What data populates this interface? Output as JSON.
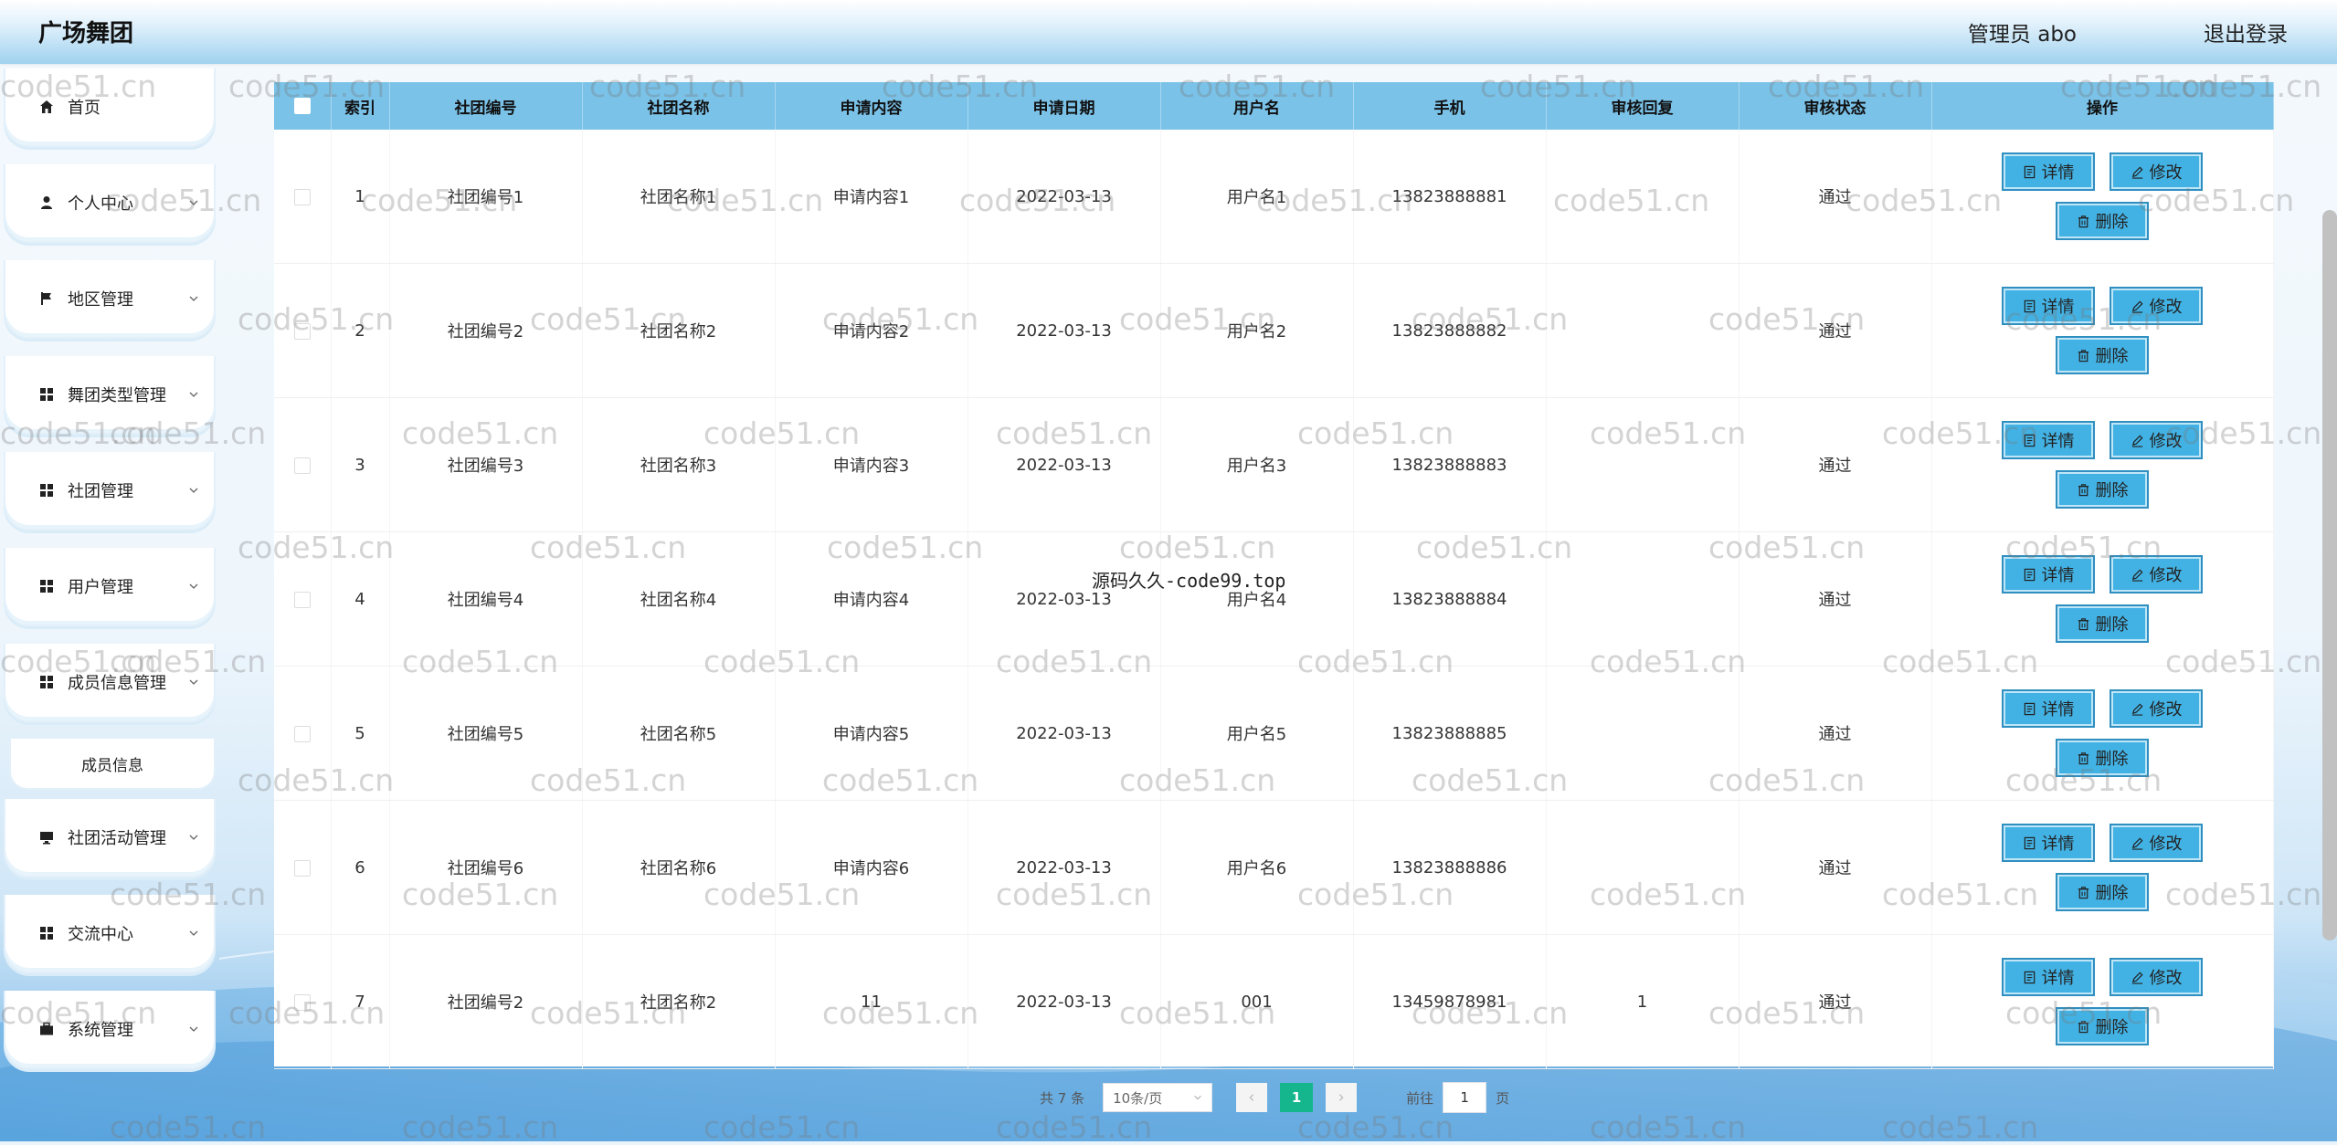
{
  "header": {
    "brand": "广场舞团",
    "admin": "管理员 abo",
    "logout": "退出登录"
  },
  "sidebar": {
    "items": [
      {
        "label": "首页",
        "icon": "home-icon",
        "expandable": false
      },
      {
        "label": "个人中心",
        "icon": "user-icon",
        "expandable": true
      },
      {
        "label": "地区管理",
        "icon": "flag-icon",
        "expandable": true
      },
      {
        "label": "舞团类型管理",
        "icon": "grid-icon",
        "expandable": true
      },
      {
        "label": "社团管理",
        "icon": "grid-icon",
        "expandable": true
      },
      {
        "label": "用户管理",
        "icon": "grid-icon",
        "expandable": true
      },
      {
        "label": "成员信息管理",
        "icon": "grid-icon",
        "expandable": true
      },
      {
        "label": "社团活动管理",
        "icon": "monitor-icon",
        "expandable": true
      },
      {
        "label": "交流中心",
        "icon": "grid-icon",
        "expandable": true
      },
      {
        "label": "系统管理",
        "icon": "briefcase-icon",
        "expandable": true
      }
    ],
    "subitem": "成员信息"
  },
  "table": {
    "headers": [
      "索引",
      "社团编号",
      "社团名称",
      "申请内容",
      "申请日期",
      "用户名",
      "手机",
      "审核回复",
      "审核状态",
      "操作"
    ],
    "rows": [
      [
        "1",
        "社团编号1",
        "社团名称1",
        "申请内容1",
        "2022-03-13",
        "用户名1",
        "13823888881",
        "",
        "通过"
      ],
      [
        "2",
        "社团编号2",
        "社团名称2",
        "申请内容2",
        "2022-03-13",
        "用户名2",
        "13823888882",
        "",
        "通过"
      ],
      [
        "3",
        "社团编号3",
        "社团名称3",
        "申请内容3",
        "2022-03-13",
        "用户名3",
        "13823888883",
        "",
        "通过"
      ],
      [
        "4",
        "社团编号4",
        "社团名称4",
        "申请内容4",
        "2022-03-13",
        "用户名4",
        "13823888884",
        "",
        "通过"
      ],
      [
        "5",
        "社团编号5",
        "社团名称5",
        "申请内容5",
        "2022-03-13",
        "用户名5",
        "13823888885",
        "",
        "通过"
      ],
      [
        "6",
        "社团编号6",
        "社团名称6",
        "申请内容6",
        "2022-03-13",
        "用户名6",
        "13823888886",
        "",
        "通过"
      ],
      [
        "7",
        "社团编号2",
        "社团名称2",
        "11",
        "2022-03-13",
        "001",
        "13459878981",
        "1",
        "通过"
      ]
    ],
    "actions": {
      "detail": "详情",
      "edit": "修改",
      "delete": "删除"
    }
  },
  "pagination": {
    "total": "共 7 条",
    "page_size": "10条/页",
    "current": "1",
    "goto_label": "前往",
    "goto_value": "1",
    "page_unit": "页"
  },
  "watermark": {
    "text": "code51.cn",
    "center": "源码久久-code99.top"
  },
  "colors": {
    "header_blue": "#7ac2e8",
    "button_blue": "#42b2e4",
    "page_active": "#15b68e"
  }
}
